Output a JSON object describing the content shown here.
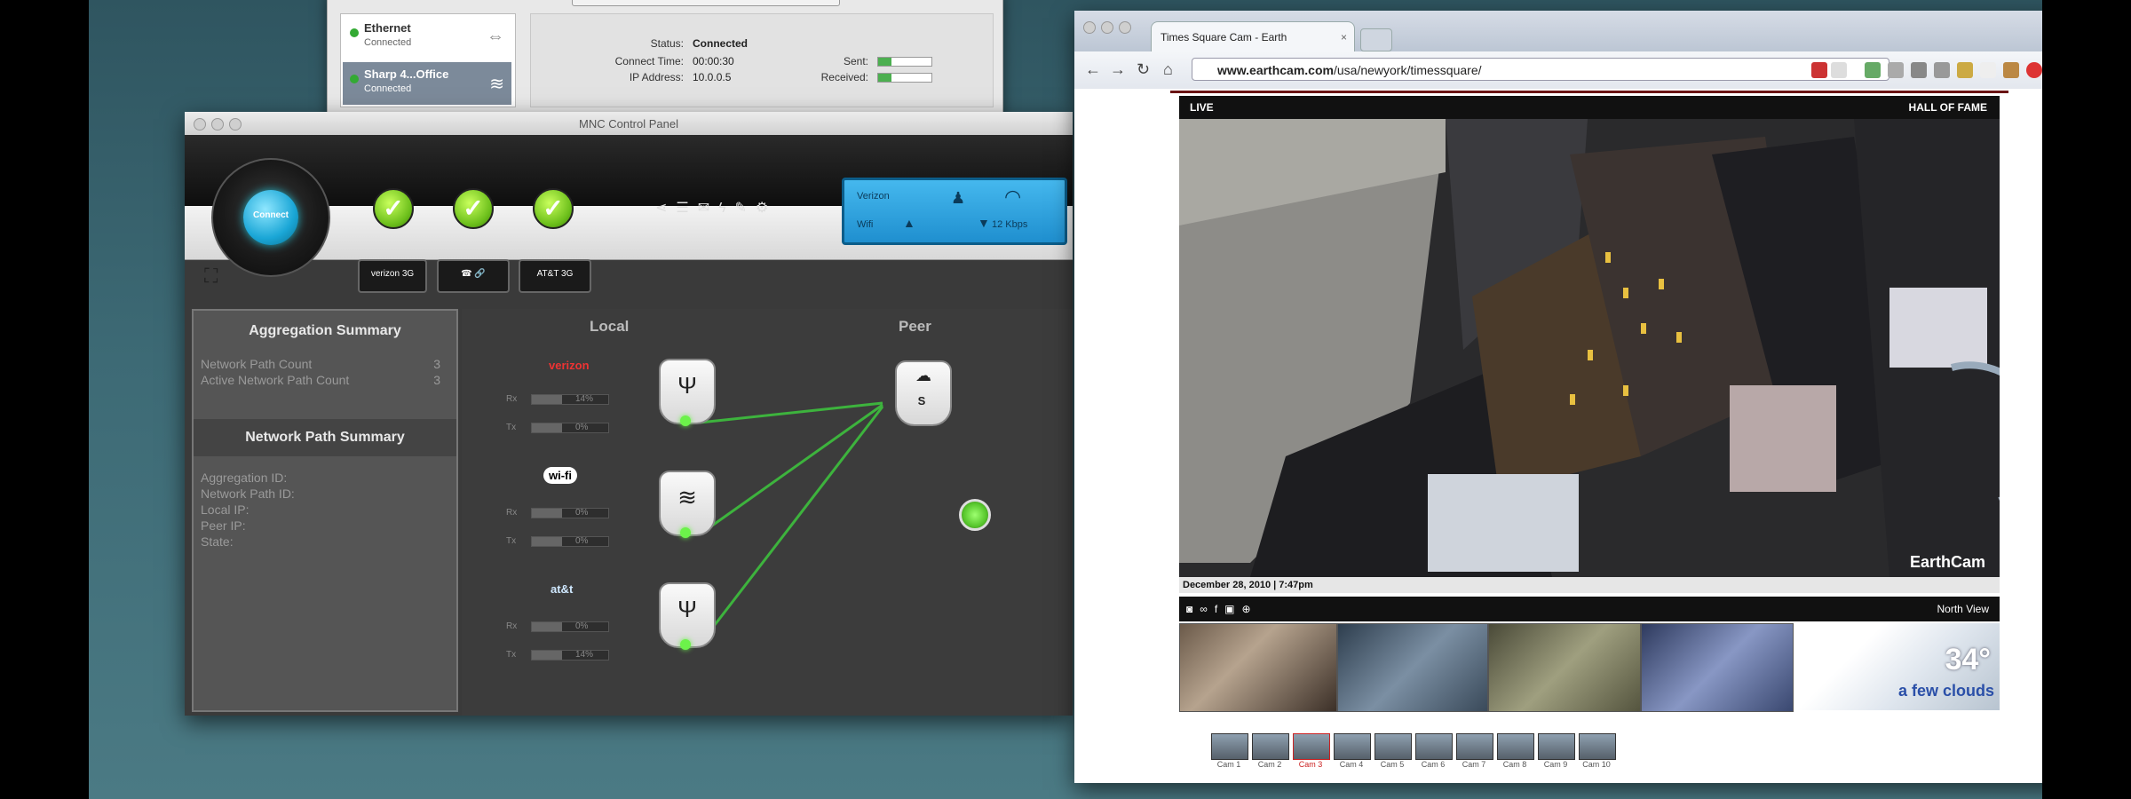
{
  "network_prefs": {
    "services": [
      {
        "name": "Ethernet",
        "status": "Connected",
        "selected": false
      },
      {
        "name": "Sharp 4...Office",
        "status": "Connected",
        "selected": true
      }
    ],
    "status_label": "Status:",
    "status_value": "Connected",
    "connect_time_label": "Connect Time:",
    "connect_time_value": "00:00:30",
    "ip_label": "IP Address:",
    "ip_value": "10.0.0.5",
    "sent_label": "Sent:",
    "received_label": "Received:"
  },
  "mnc": {
    "window_title": "MNC Control Panel",
    "logo_text": "Connect",
    "toolbar_buttons": [
      "verizon 3G",
      "☎ 🔗",
      "AT&T 3G"
    ],
    "lcd": {
      "line1": "Verizon",
      "line2": "Wifi",
      "line3": "12 Kbps"
    },
    "aggregation": {
      "title": "Aggregation Summary",
      "rows": [
        {
          "label": "Network Path Count",
          "value": "3"
        },
        {
          "label": "Active Network Path Count",
          "value": "3"
        }
      ]
    },
    "path_summary": {
      "title": "Network Path Summary",
      "rows": [
        "Aggregation ID:",
        "Network Path ID:",
        "Local IP:",
        "Peer IP:",
        "State:"
      ]
    },
    "local_label": "Local",
    "peer_label": "Peer",
    "paths": [
      {
        "brand": "verizon",
        "rx": "Rx",
        "tx": "Tx",
        "rx_pct": "14%",
        "tx_pct": "0%"
      },
      {
        "brand": "wi-fi",
        "rx": "Rx",
        "tx": "Tx",
        "rx_pct": "0%",
        "tx_pct": "0%"
      },
      {
        "brand": "at&t",
        "rx": "Rx",
        "tx": "Tx",
        "rx_pct": "0%",
        "tx_pct": "14%"
      }
    ],
    "peer_node_label": "S"
  },
  "browser": {
    "tab_title": "Times Square Cam - Earth",
    "url_host": "www.earthcam.com",
    "url_path": "/usa/newyork/timessquare/",
    "player": {
      "live_label": "LIVE",
      "hall_label": "HALL OF FAME",
      "watermark": "EarthCam",
      "date": "December 28, 2010 | 7:47pm",
      "ctrl_right": "North View",
      "temperature": "34°",
      "conditions": "a few clouds",
      "cams": [
        "Cam 1",
        "Cam 2",
        "Cam 3",
        "Cam 4",
        "Cam 5",
        "Cam 6",
        "Cam 7",
        "Cam 8",
        "Cam 9",
        "Cam 10"
      ]
    }
  },
  "colors": {
    "accent_green": "#6cbf1b",
    "lcd_blue": "#1f8fcf",
    "earthcam_red": "#6a1414"
  }
}
